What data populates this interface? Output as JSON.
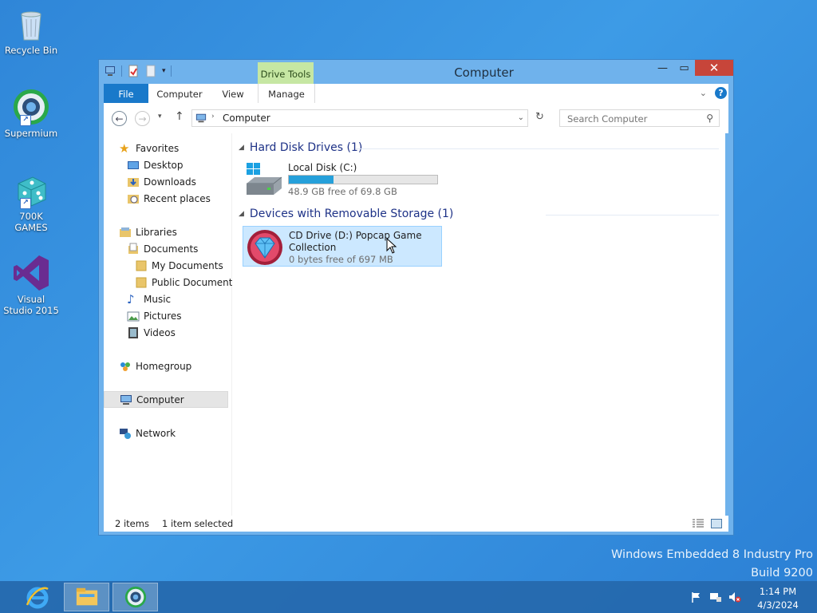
{
  "desktop": {
    "icons": [
      {
        "label": "Recycle Bin",
        "icon": "recycle-bin-icon"
      },
      {
        "label": "Supermium",
        "icon": "supermium-icon"
      },
      {
        "label": "700K GAMES",
        "icon": "dice-icon"
      },
      {
        "label": "Visual Studio 2015",
        "icon": "visual-studio-icon"
      }
    ],
    "watermark": {
      "line1": "Windows Embedded 8 Industry Pro",
      "line2": "Build 9200"
    }
  },
  "window": {
    "title": "Computer",
    "context_tab_group": "Drive Tools",
    "ribbon_tabs": [
      "File",
      "Computer",
      "View",
      "Manage"
    ],
    "address": {
      "path": "Computer"
    },
    "search": {
      "placeholder": "Search Computer"
    },
    "nav": {
      "favorites": {
        "label": "Favorites",
        "items": [
          "Desktop",
          "Downloads",
          "Recent places"
        ]
      },
      "libraries": {
        "label": "Libraries",
        "documents": "Documents",
        "documents_children": [
          "My Documents",
          "Public Documents"
        ],
        "items": [
          "Music",
          "Pictures",
          "Videos"
        ]
      },
      "homegroup": "Homegroup",
      "computer": "Computer",
      "network": "Network"
    },
    "groups": [
      {
        "title": "Hard Disk Drives (1)",
        "drives": [
          {
            "name": "Local Disk (C:)",
            "free_text": "48.9 GB free of 69.8 GB",
            "used_fraction": 0.3
          }
        ]
      },
      {
        "title": "Devices with Removable Storage (1)",
        "drives": [
          {
            "name": "CD Drive (D:) Popcap Game Collection",
            "free_text": "0 bytes free of 697 MB"
          }
        ]
      }
    ],
    "status": {
      "items": "2 items",
      "selected": "1 item selected"
    }
  },
  "taskbar": {
    "apps": [
      "internet-explorer-icon",
      "file-explorer-icon",
      "supermium-icon"
    ],
    "clock": {
      "time": "1:14 PM",
      "date": "4/3/2024"
    }
  },
  "colors": {
    "accent": "#1979ca",
    "selection": "#cce8ff",
    "close": "#c7453a",
    "context_tab": "#c6e7a3",
    "usage_bar": "#26a0da"
  }
}
